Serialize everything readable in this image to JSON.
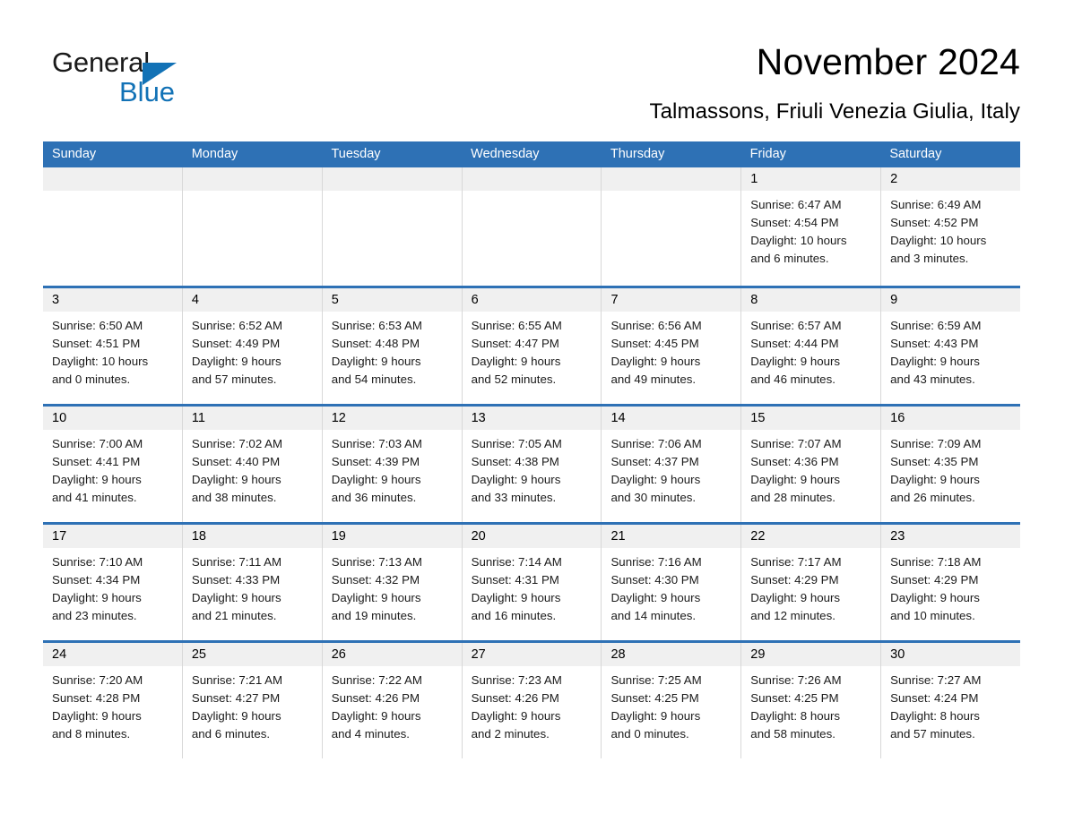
{
  "brand": {
    "name_part1": "General",
    "name_part2": "Blue",
    "accent_color": "#1272b6"
  },
  "header": {
    "month_title": "November 2024",
    "location": "Talmassons, Friuli Venezia Giulia, Italy"
  },
  "theme": {
    "header_blue": "#2e71b5",
    "day_band_gray": "#f0f0f0",
    "cell_border": "#d8d8d8"
  },
  "weekday_headers": [
    "Sunday",
    "Monday",
    "Tuesday",
    "Wednesday",
    "Thursday",
    "Friday",
    "Saturday"
  ],
  "weeks": [
    [
      {
        "day": "",
        "sunrise": "",
        "sunset": "",
        "daylight_line1": "",
        "daylight_line2": "",
        "empty": true
      },
      {
        "day": "",
        "sunrise": "",
        "sunset": "",
        "daylight_line1": "",
        "daylight_line2": "",
        "empty": true
      },
      {
        "day": "",
        "sunrise": "",
        "sunset": "",
        "daylight_line1": "",
        "daylight_line2": "",
        "empty": true
      },
      {
        "day": "",
        "sunrise": "",
        "sunset": "",
        "daylight_line1": "",
        "daylight_line2": "",
        "empty": true
      },
      {
        "day": "",
        "sunrise": "",
        "sunset": "",
        "daylight_line1": "",
        "daylight_line2": "",
        "empty": true
      },
      {
        "day": "1",
        "sunrise": "Sunrise: 6:47 AM",
        "sunset": "Sunset: 4:54 PM",
        "daylight_line1": "Daylight: 10 hours",
        "daylight_line2": "and 6 minutes.",
        "empty": false
      },
      {
        "day": "2",
        "sunrise": "Sunrise: 6:49 AM",
        "sunset": "Sunset: 4:52 PM",
        "daylight_line1": "Daylight: 10 hours",
        "daylight_line2": "and 3 minutes.",
        "empty": false
      }
    ],
    [
      {
        "day": "3",
        "sunrise": "Sunrise: 6:50 AM",
        "sunset": "Sunset: 4:51 PM",
        "daylight_line1": "Daylight: 10 hours",
        "daylight_line2": "and 0 minutes.",
        "empty": false
      },
      {
        "day": "4",
        "sunrise": "Sunrise: 6:52 AM",
        "sunset": "Sunset: 4:49 PM",
        "daylight_line1": "Daylight: 9 hours",
        "daylight_line2": "and 57 minutes.",
        "empty": false
      },
      {
        "day": "5",
        "sunrise": "Sunrise: 6:53 AM",
        "sunset": "Sunset: 4:48 PM",
        "daylight_line1": "Daylight: 9 hours",
        "daylight_line2": "and 54 minutes.",
        "empty": false
      },
      {
        "day": "6",
        "sunrise": "Sunrise: 6:55 AM",
        "sunset": "Sunset: 4:47 PM",
        "daylight_line1": "Daylight: 9 hours",
        "daylight_line2": "and 52 minutes.",
        "empty": false
      },
      {
        "day": "7",
        "sunrise": "Sunrise: 6:56 AM",
        "sunset": "Sunset: 4:45 PM",
        "daylight_line1": "Daylight: 9 hours",
        "daylight_line2": "and 49 minutes.",
        "empty": false
      },
      {
        "day": "8",
        "sunrise": "Sunrise: 6:57 AM",
        "sunset": "Sunset: 4:44 PM",
        "daylight_line1": "Daylight: 9 hours",
        "daylight_line2": "and 46 minutes.",
        "empty": false
      },
      {
        "day": "9",
        "sunrise": "Sunrise: 6:59 AM",
        "sunset": "Sunset: 4:43 PM",
        "daylight_line1": "Daylight: 9 hours",
        "daylight_line2": "and 43 minutes.",
        "empty": false
      }
    ],
    [
      {
        "day": "10",
        "sunrise": "Sunrise: 7:00 AM",
        "sunset": "Sunset: 4:41 PM",
        "daylight_line1": "Daylight: 9 hours",
        "daylight_line2": "and 41 minutes.",
        "empty": false
      },
      {
        "day": "11",
        "sunrise": "Sunrise: 7:02 AM",
        "sunset": "Sunset: 4:40 PM",
        "daylight_line1": "Daylight: 9 hours",
        "daylight_line2": "and 38 minutes.",
        "empty": false
      },
      {
        "day": "12",
        "sunrise": "Sunrise: 7:03 AM",
        "sunset": "Sunset: 4:39 PM",
        "daylight_line1": "Daylight: 9 hours",
        "daylight_line2": "and 36 minutes.",
        "empty": false
      },
      {
        "day": "13",
        "sunrise": "Sunrise: 7:05 AM",
        "sunset": "Sunset: 4:38 PM",
        "daylight_line1": "Daylight: 9 hours",
        "daylight_line2": "and 33 minutes.",
        "empty": false
      },
      {
        "day": "14",
        "sunrise": "Sunrise: 7:06 AM",
        "sunset": "Sunset: 4:37 PM",
        "daylight_line1": "Daylight: 9 hours",
        "daylight_line2": "and 30 minutes.",
        "empty": false
      },
      {
        "day": "15",
        "sunrise": "Sunrise: 7:07 AM",
        "sunset": "Sunset: 4:36 PM",
        "daylight_line1": "Daylight: 9 hours",
        "daylight_line2": "and 28 minutes.",
        "empty": false
      },
      {
        "day": "16",
        "sunrise": "Sunrise: 7:09 AM",
        "sunset": "Sunset: 4:35 PM",
        "daylight_line1": "Daylight: 9 hours",
        "daylight_line2": "and 26 minutes.",
        "empty": false
      }
    ],
    [
      {
        "day": "17",
        "sunrise": "Sunrise: 7:10 AM",
        "sunset": "Sunset: 4:34 PM",
        "daylight_line1": "Daylight: 9 hours",
        "daylight_line2": "and 23 minutes.",
        "empty": false
      },
      {
        "day": "18",
        "sunrise": "Sunrise: 7:11 AM",
        "sunset": "Sunset: 4:33 PM",
        "daylight_line1": "Daylight: 9 hours",
        "daylight_line2": "and 21 minutes.",
        "empty": false
      },
      {
        "day": "19",
        "sunrise": "Sunrise: 7:13 AM",
        "sunset": "Sunset: 4:32 PM",
        "daylight_line1": "Daylight: 9 hours",
        "daylight_line2": "and 19 minutes.",
        "empty": false
      },
      {
        "day": "20",
        "sunrise": "Sunrise: 7:14 AM",
        "sunset": "Sunset: 4:31 PM",
        "daylight_line1": "Daylight: 9 hours",
        "daylight_line2": "and 16 minutes.",
        "empty": false
      },
      {
        "day": "21",
        "sunrise": "Sunrise: 7:16 AM",
        "sunset": "Sunset: 4:30 PM",
        "daylight_line1": "Daylight: 9 hours",
        "daylight_line2": "and 14 minutes.",
        "empty": false
      },
      {
        "day": "22",
        "sunrise": "Sunrise: 7:17 AM",
        "sunset": "Sunset: 4:29 PM",
        "daylight_line1": "Daylight: 9 hours",
        "daylight_line2": "and 12 minutes.",
        "empty": false
      },
      {
        "day": "23",
        "sunrise": "Sunrise: 7:18 AM",
        "sunset": "Sunset: 4:29 PM",
        "daylight_line1": "Daylight: 9 hours",
        "daylight_line2": "and 10 minutes.",
        "empty": false
      }
    ],
    [
      {
        "day": "24",
        "sunrise": "Sunrise: 7:20 AM",
        "sunset": "Sunset: 4:28 PM",
        "daylight_line1": "Daylight: 9 hours",
        "daylight_line2": "and 8 minutes.",
        "empty": false
      },
      {
        "day": "25",
        "sunrise": "Sunrise: 7:21 AM",
        "sunset": "Sunset: 4:27 PM",
        "daylight_line1": "Daylight: 9 hours",
        "daylight_line2": "and 6 minutes.",
        "empty": false
      },
      {
        "day": "26",
        "sunrise": "Sunrise: 7:22 AM",
        "sunset": "Sunset: 4:26 PM",
        "daylight_line1": "Daylight: 9 hours",
        "daylight_line2": "and 4 minutes.",
        "empty": false
      },
      {
        "day": "27",
        "sunrise": "Sunrise: 7:23 AM",
        "sunset": "Sunset: 4:26 PM",
        "daylight_line1": "Daylight: 9 hours",
        "daylight_line2": "and 2 minutes.",
        "empty": false
      },
      {
        "day": "28",
        "sunrise": "Sunrise: 7:25 AM",
        "sunset": "Sunset: 4:25 PM",
        "daylight_line1": "Daylight: 9 hours",
        "daylight_line2": "and 0 minutes.",
        "empty": false
      },
      {
        "day": "29",
        "sunrise": "Sunrise: 7:26 AM",
        "sunset": "Sunset: 4:25 PM",
        "daylight_line1": "Daylight: 8 hours",
        "daylight_line2": "and 58 minutes.",
        "empty": false
      },
      {
        "day": "30",
        "sunrise": "Sunrise: 7:27 AM",
        "sunset": "Sunset: 4:24 PM",
        "daylight_line1": "Daylight: 8 hours",
        "daylight_line2": "and 57 minutes.",
        "empty": false
      }
    ]
  ]
}
